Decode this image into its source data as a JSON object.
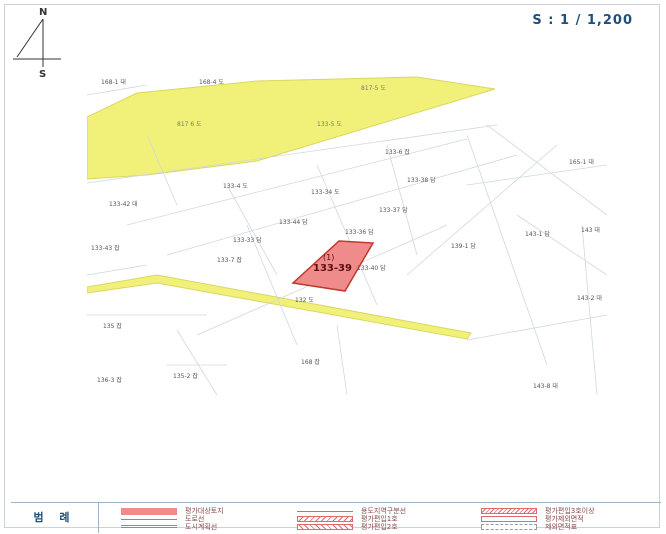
{
  "scale": "S : 1 / 1,200",
  "compass": {
    "north": "N",
    "south": "S"
  },
  "subject_parcel": {
    "mark": "(1)",
    "number": "133-39"
  },
  "parcel_labels": [
    "168-1 대",
    "168-4 도",
    "817 6 도",
    "817-5 도",
    "133-5 도",
    "133-4 도",
    "133-6 잡",
    "133-42 대",
    "133-34 도",
    "133-38 답",
    "133-37 답",
    "133-44 답",
    "133-36 답",
    "133-33 답",
    "133-43 잡",
    "133-7 잡",
    "139-1 답",
    "165-1 대",
    "143 대",
    "143-1 답",
    "143-2 대",
    "135 잡",
    "168 잡",
    "136-3 잡",
    "135-2 잡",
    "143-8 대",
    "132 도",
    "133-40 답"
  ],
  "legend": {
    "title": "범 례",
    "items": [
      {
        "label": "평가대상토지",
        "color": "#f08b8b"
      },
      {
        "label": "도로선",
        "color": "#e06a6a"
      },
      {
        "label": "도시계획선",
        "color": "#e06a6a"
      },
      {
        "label": "용도지역구분선",
        "color": "#888888"
      },
      {
        "label": "평가편입1호",
        "color": "#e06a6a"
      },
      {
        "label": "평가편입2호",
        "color": "#e06a6a"
      },
      {
        "label": "평가편입3호이상",
        "color": "#e06a6a"
      },
      {
        "label": "평가제외면적",
        "color": "#e06a6a"
      },
      {
        "label": "제외면적표",
        "color": "#999999"
      }
    ]
  }
}
